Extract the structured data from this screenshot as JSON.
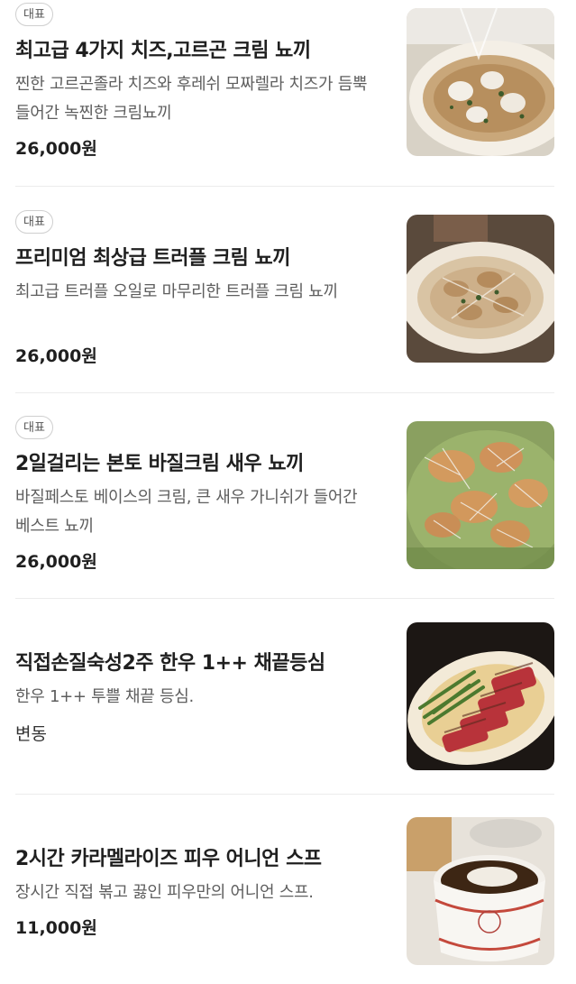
{
  "menu": {
    "items": [
      {
        "badge": "대표",
        "title": "최고급 4가지 치즈,고르곤 크림 뇨끼",
        "description": "찐한 고르곤졸라 치즈와 후레쉬 모짜렐라 치즈가 듬뿍 들어간 녹찐한 크림뇨끼",
        "price": "26,000원",
        "image": "cheese-cream-gnocchi-photo"
      },
      {
        "badge": "대표",
        "title": "프리미엄 최상급 트러플 크림 뇨끼",
        "description": "최고급 트러플 오일로 마무리한 트러플 크림 뇨끼",
        "price": "26,000원",
        "image": "truffle-cream-gnocchi-photo"
      },
      {
        "badge": "대표",
        "title": "2일걸리는 본토 바질크림 새우 뇨끼",
        "description": "바질페스토 베이스의 크림, 큰 새우 가니쉬가 들어간 베스트 뇨끼",
        "price": "26,000원",
        "image": "basil-shrimp-gnocchi-photo"
      },
      {
        "title": "직접손질숙성2주 한우 1++ 채끝등심",
        "description": "한우 1++ 투쁠 채끝 등심.",
        "price": "변동",
        "image": "hanwoo-sirloin-steak-photo"
      },
      {
        "title": "2시간 카라멜라이즈 피우 어니언 스프",
        "description": "장시간 직접 볶고 끓인 피우만의 어니언 스프.",
        "price": "11,000원",
        "image": "onion-soup-photo"
      }
    ]
  }
}
